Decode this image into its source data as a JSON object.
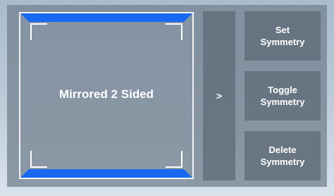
{
  "preview": {
    "label": "Mirrored 2 Sided"
  },
  "next_button": {
    "label": ">"
  },
  "buttons": {
    "set_symmetry": {
      "line1": "Set",
      "line2": "Symmetry"
    },
    "toggle_symmetry": {
      "line1": "Toggle",
      "line2": "Symmetry"
    },
    "delete_symmetry": {
      "line1": "Delete",
      "line2": "Symmetry"
    }
  },
  "colors": {
    "accent_blue": "#1769f2",
    "panel": "#76848f",
    "button": "#56626e",
    "text": "#ffffff"
  }
}
